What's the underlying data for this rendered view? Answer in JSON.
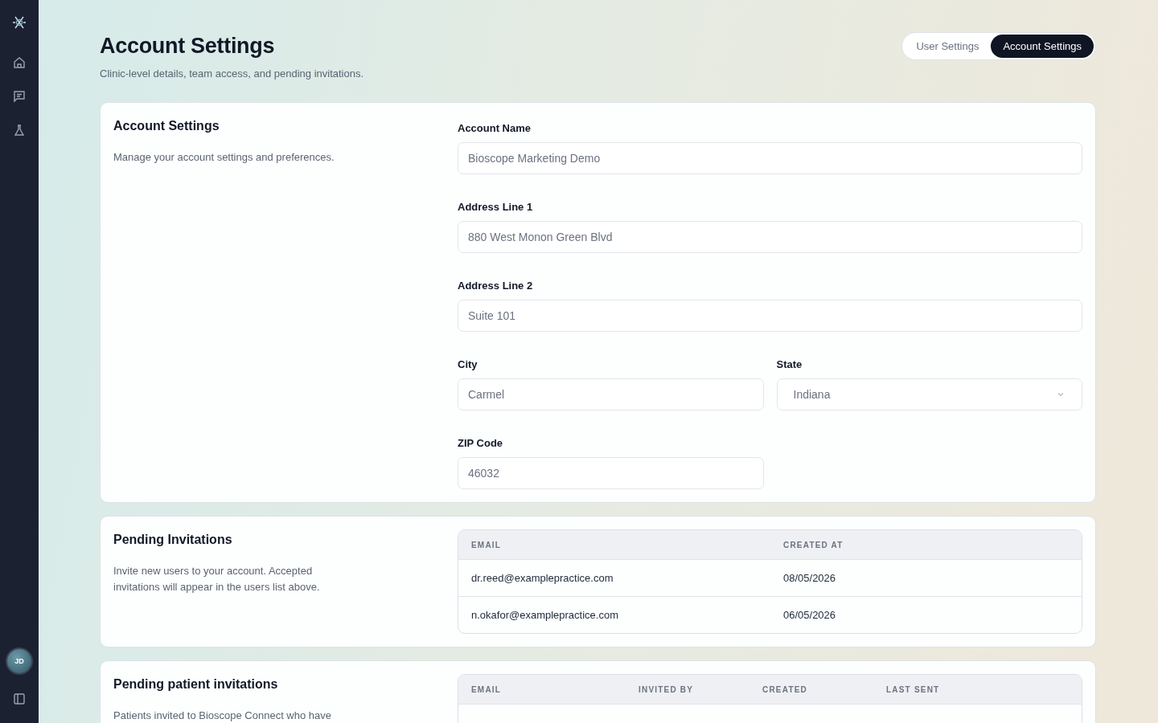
{
  "sidebar": {
    "avatar": "JD"
  },
  "header": {
    "title": "Account Settings",
    "subtitle": "Clinic-level details, team access, and pending invitations."
  },
  "tabs": [
    {
      "label": "User Settings",
      "selected": false
    },
    {
      "label": "Account Settings",
      "selected": true
    }
  ],
  "account_card": {
    "title": "Account Settings",
    "description": "Manage your account settings and preferences.",
    "fields": [
      {
        "label": "Account Name",
        "value": "Bioscope Marketing Demo",
        "kind": "text"
      },
      {
        "label": "Address Line 1",
        "value": "880 West Monon Green Blvd",
        "kind": "text"
      },
      {
        "label": "Address Line 2",
        "value": "Suite 101",
        "kind": "text"
      },
      {
        "label": "City",
        "value": "Carmel",
        "kind": "text"
      },
      {
        "label": "State",
        "value": "Indiana",
        "kind": "select"
      },
      {
        "label": "ZIP Code",
        "value": "46032",
        "kind": "text"
      }
    ]
  },
  "invitations_card": {
    "title": "Pending Invitations",
    "description": "Invite new users to your account. Accepted invitations will appear in the users list above.",
    "table": {
      "columns": [
        "EMAIL",
        "CREATED AT"
      ],
      "rows": [
        [
          "dr.reed@examplepractice.com",
          "08/05/2026"
        ],
        [
          "n.okafor@examplepractice.com",
          "06/05/2026"
        ]
      ]
    }
  },
  "patient_card": {
    "title": "Pending patient invitations",
    "description": "Patients invited to Bioscope Connect who have",
    "table": {
      "columns": [
        "EMAIL",
        "INVITED BY",
        "CREATED",
        "LAST SENT"
      ]
    }
  }
}
